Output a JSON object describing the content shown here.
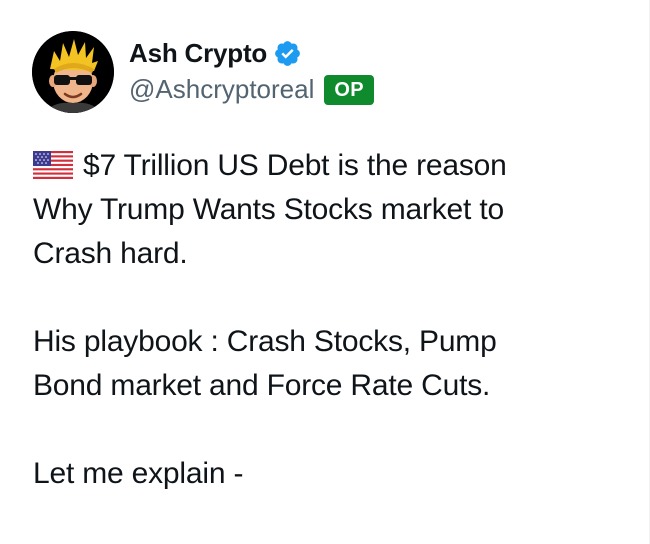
{
  "author": {
    "display_name": "Ash Crypto",
    "handle": "@Ashcryptoreal",
    "badge": "OP",
    "verified": true
  },
  "post": {
    "flag_icon": "us-flag-icon",
    "lines": [
      "$7 Trillion US Debt is the reason",
      "Why Trump Wants Stocks market to",
      "Crash hard.",
      "",
      "His playbook : Crash Stocks, Pump",
      "Bond market and Force Rate Cuts.",
      "",
      "Let me explain -"
    ]
  },
  "colors": {
    "text": "#0f1419",
    "secondary_text": "#536471",
    "verified_blue": "#1d9bf0",
    "op_badge_green": "#0f8a2d"
  }
}
